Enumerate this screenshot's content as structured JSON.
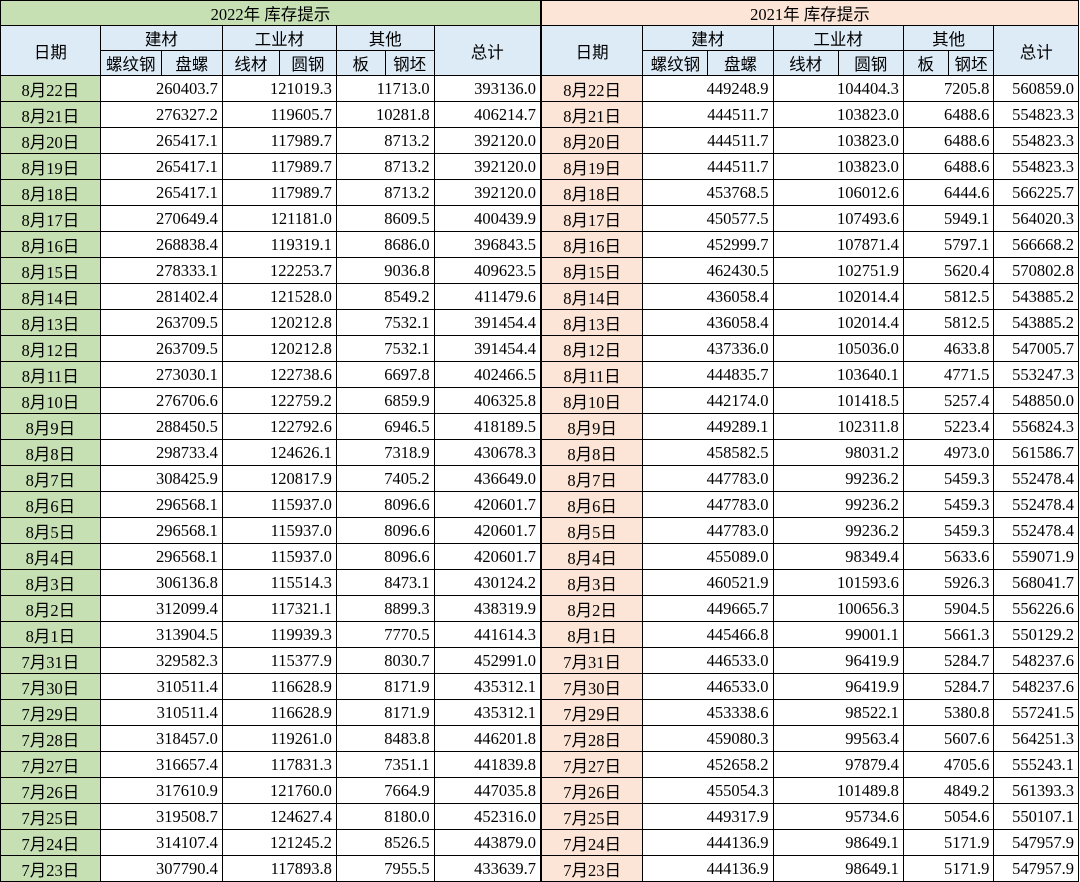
{
  "titles": {
    "y2022": "2022年 库存提示",
    "y2021": "2021年 库存提示"
  },
  "headers": {
    "date": "日期",
    "jiancai": "建材",
    "gongye": "工业材",
    "qita": "其他",
    "total": "总计",
    "luowengang": "螺纹钢",
    "panluo": "盘螺",
    "xiancai": "线材",
    "yuangang": "圆钢",
    "ban": "板",
    "gangpi": "钢坯"
  },
  "colors": {
    "title_2022_bg": "#c6e0b4",
    "title_2021_bg": "#fce4d6",
    "header_bg": "#ddebf7"
  },
  "rows": [
    {
      "d22": "8月22日",
      "a1": "260403.7",
      "a2": "121019.3",
      "a3": "11713.0",
      "a4": "393136.0",
      "d21": "8月22日",
      "b1": "449248.9",
      "b2": "104404.3",
      "b3": "7205.8",
      "b4": "560859.0"
    },
    {
      "d22": "8月21日",
      "a1": "276327.2",
      "a2": "119605.7",
      "a3": "10281.8",
      "a4": "406214.7",
      "d21": "8月21日",
      "b1": "444511.7",
      "b2": "103823.0",
      "b3": "6488.6",
      "b4": "554823.3"
    },
    {
      "d22": "8月20日",
      "a1": "265417.1",
      "a2": "117989.7",
      "a3": "8713.2",
      "a4": "392120.0",
      "d21": "8月20日",
      "b1": "444511.7",
      "b2": "103823.0",
      "b3": "6488.6",
      "b4": "554823.3"
    },
    {
      "d22": "8月19日",
      "a1": "265417.1",
      "a2": "117989.7",
      "a3": "8713.2",
      "a4": "392120.0",
      "d21": "8月19日",
      "b1": "444511.7",
      "b2": "103823.0",
      "b3": "6488.6",
      "b4": "554823.3"
    },
    {
      "d22": "8月18日",
      "a1": "265417.1",
      "a2": "117989.7",
      "a3": "8713.2",
      "a4": "392120.0",
      "d21": "8月18日",
      "b1": "453768.5",
      "b2": "106012.6",
      "b3": "6444.6",
      "b4": "566225.7"
    },
    {
      "d22": "8月17日",
      "a1": "270649.4",
      "a2": "121181.0",
      "a3": "8609.5",
      "a4": "400439.9",
      "d21": "8月17日",
      "b1": "450577.5",
      "b2": "107493.6",
      "b3": "5949.1",
      "b4": "564020.3"
    },
    {
      "d22": "8月16日",
      "a1": "268838.4",
      "a2": "119319.1",
      "a3": "8686.0",
      "a4": "396843.5",
      "d21": "8月16日",
      "b1": "452999.7",
      "b2": "107871.4",
      "b3": "5797.1",
      "b4": "566668.2"
    },
    {
      "d22": "8月15日",
      "a1": "278333.1",
      "a2": "122253.7",
      "a3": "9036.8",
      "a4": "409623.5",
      "d21": "8月15日",
      "b1": "462430.5",
      "b2": "102751.9",
      "b3": "5620.4",
      "b4": "570802.8"
    },
    {
      "d22": "8月14日",
      "a1": "281402.4",
      "a2": "121528.0",
      "a3": "8549.2",
      "a4": "411479.6",
      "d21": "8月14日",
      "b1": "436058.4",
      "b2": "102014.4",
      "b3": "5812.5",
      "b4": "543885.2"
    },
    {
      "d22": "8月13日",
      "a1": "263709.5",
      "a2": "120212.8",
      "a3": "7532.1",
      "a4": "391454.4",
      "d21": "8月13日",
      "b1": "436058.4",
      "b2": "102014.4",
      "b3": "5812.5",
      "b4": "543885.2"
    },
    {
      "d22": "8月12日",
      "a1": "263709.5",
      "a2": "120212.8",
      "a3": "7532.1",
      "a4": "391454.4",
      "d21": "8月12日",
      "b1": "437336.0",
      "b2": "105036.0",
      "b3": "4633.8",
      "b4": "547005.7"
    },
    {
      "d22": "8月11日",
      "a1": "273030.1",
      "a2": "122738.6",
      "a3": "6697.8",
      "a4": "402466.5",
      "d21": "8月11日",
      "b1": "444835.7",
      "b2": "103640.1",
      "b3": "4771.5",
      "b4": "553247.3"
    },
    {
      "d22": "8月10日",
      "a1": "276706.6",
      "a2": "122759.2",
      "a3": "6859.9",
      "a4": "406325.8",
      "d21": "8月10日",
      "b1": "442174.0",
      "b2": "101418.5",
      "b3": "5257.4",
      "b4": "548850.0"
    },
    {
      "d22": "8月9日",
      "a1": "288450.5",
      "a2": "122792.6",
      "a3": "6946.5",
      "a4": "418189.5",
      "d21": "8月9日",
      "b1": "449289.1",
      "b2": "102311.8",
      "b3": "5223.4",
      "b4": "556824.3"
    },
    {
      "d22": "8月8日",
      "a1": "298733.4",
      "a2": "124626.1",
      "a3": "7318.9",
      "a4": "430678.3",
      "d21": "8月8日",
      "b1": "458582.5",
      "b2": "98031.2",
      "b3": "4973.0",
      "b4": "561586.7"
    },
    {
      "d22": "8月7日",
      "a1": "308425.9",
      "a2": "120817.9",
      "a3": "7405.2",
      "a4": "436649.0",
      "d21": "8月7日",
      "b1": "447783.0",
      "b2": "99236.2",
      "b3": "5459.3",
      "b4": "552478.4"
    },
    {
      "d22": "8月6日",
      "a1": "296568.1",
      "a2": "115937.0",
      "a3": "8096.6",
      "a4": "420601.7",
      "d21": "8月6日",
      "b1": "447783.0",
      "b2": "99236.2",
      "b3": "5459.3",
      "b4": "552478.4"
    },
    {
      "d22": "8月5日",
      "a1": "296568.1",
      "a2": "115937.0",
      "a3": "8096.6",
      "a4": "420601.7",
      "d21": "8月5日",
      "b1": "447783.0",
      "b2": "99236.2",
      "b3": "5459.3",
      "b4": "552478.4"
    },
    {
      "d22": "8月4日",
      "a1": "296568.1",
      "a2": "115937.0",
      "a3": "8096.6",
      "a4": "420601.7",
      "d21": "8月4日",
      "b1": "455089.0",
      "b2": "98349.4",
      "b3": "5633.6",
      "b4": "559071.9"
    },
    {
      "d22": "8月3日",
      "a1": "306136.8",
      "a2": "115514.3",
      "a3": "8473.1",
      "a4": "430124.2",
      "d21": "8月3日",
      "b1": "460521.9",
      "b2": "101593.6",
      "b3": "5926.3",
      "b4": "568041.7"
    },
    {
      "d22": "8月2日",
      "a1": "312099.4",
      "a2": "117321.1",
      "a3": "8899.3",
      "a4": "438319.9",
      "d21": "8月2日",
      "b1": "449665.7",
      "b2": "100656.3",
      "b3": "5904.5",
      "b4": "556226.6"
    },
    {
      "d22": "8月1日",
      "a1": "313904.5",
      "a2": "119939.3",
      "a3": "7770.5",
      "a4": "441614.3",
      "d21": "8月1日",
      "b1": "445466.8",
      "b2": "99001.1",
      "b3": "5661.3",
      "b4": "550129.2"
    },
    {
      "d22": "7月31日",
      "a1": "329582.3",
      "a2": "115377.9",
      "a3": "8030.7",
      "a4": "452991.0",
      "d21": "7月31日",
      "b1": "446533.0",
      "b2": "96419.9",
      "b3": "5284.7",
      "b4": "548237.6"
    },
    {
      "d22": "7月30日",
      "a1": "310511.4",
      "a2": "116628.9",
      "a3": "8171.9",
      "a4": "435312.1",
      "d21": "7月30日",
      "b1": "446533.0",
      "b2": "96419.9",
      "b3": "5284.7",
      "b4": "548237.6"
    },
    {
      "d22": "7月29日",
      "a1": "310511.4",
      "a2": "116628.9",
      "a3": "8171.9",
      "a4": "435312.1",
      "d21": "7月29日",
      "b1": "453338.6",
      "b2": "98522.1",
      "b3": "5380.8",
      "b4": "557241.5"
    },
    {
      "d22": "7月28日",
      "a1": "318457.0",
      "a2": "119261.0",
      "a3": "8483.8",
      "a4": "446201.8",
      "d21": "7月28日",
      "b1": "459080.3",
      "b2": "99563.4",
      "b3": "5607.6",
      "b4": "564251.3"
    },
    {
      "d22": "7月27日",
      "a1": "316657.4",
      "a2": "117831.3",
      "a3": "7351.1",
      "a4": "441839.8",
      "d21": "7月27日",
      "b1": "452658.2",
      "b2": "97879.4",
      "b3": "4705.6",
      "b4": "555243.1"
    },
    {
      "d22": "7月26日",
      "a1": "317610.9",
      "a2": "121760.0",
      "a3": "7664.9",
      "a4": "447035.8",
      "d21": "7月26日",
      "b1": "455054.3",
      "b2": "101489.8",
      "b3": "4849.2",
      "b4": "561393.3"
    },
    {
      "d22": "7月25日",
      "a1": "319508.7",
      "a2": "124627.4",
      "a3": "8180.0",
      "a4": "452316.0",
      "d21": "7月25日",
      "b1": "449317.9",
      "b2": "95734.6",
      "b3": "5054.6",
      "b4": "550107.1"
    },
    {
      "d22": "7月24日",
      "a1": "314107.4",
      "a2": "121245.2",
      "a3": "8526.5",
      "a4": "443879.0",
      "d21": "7月24日",
      "b1": "444136.9",
      "b2": "98649.1",
      "b3": "5171.9",
      "b4": "547957.9"
    },
    {
      "d22": "7月23日",
      "a1": "307790.4",
      "a2": "117893.8",
      "a3": "7955.5",
      "a4": "433639.7",
      "d21": "7月23日",
      "b1": "444136.9",
      "b2": "98649.1",
      "b3": "5171.9",
      "b4": "547957.9"
    }
  ]
}
